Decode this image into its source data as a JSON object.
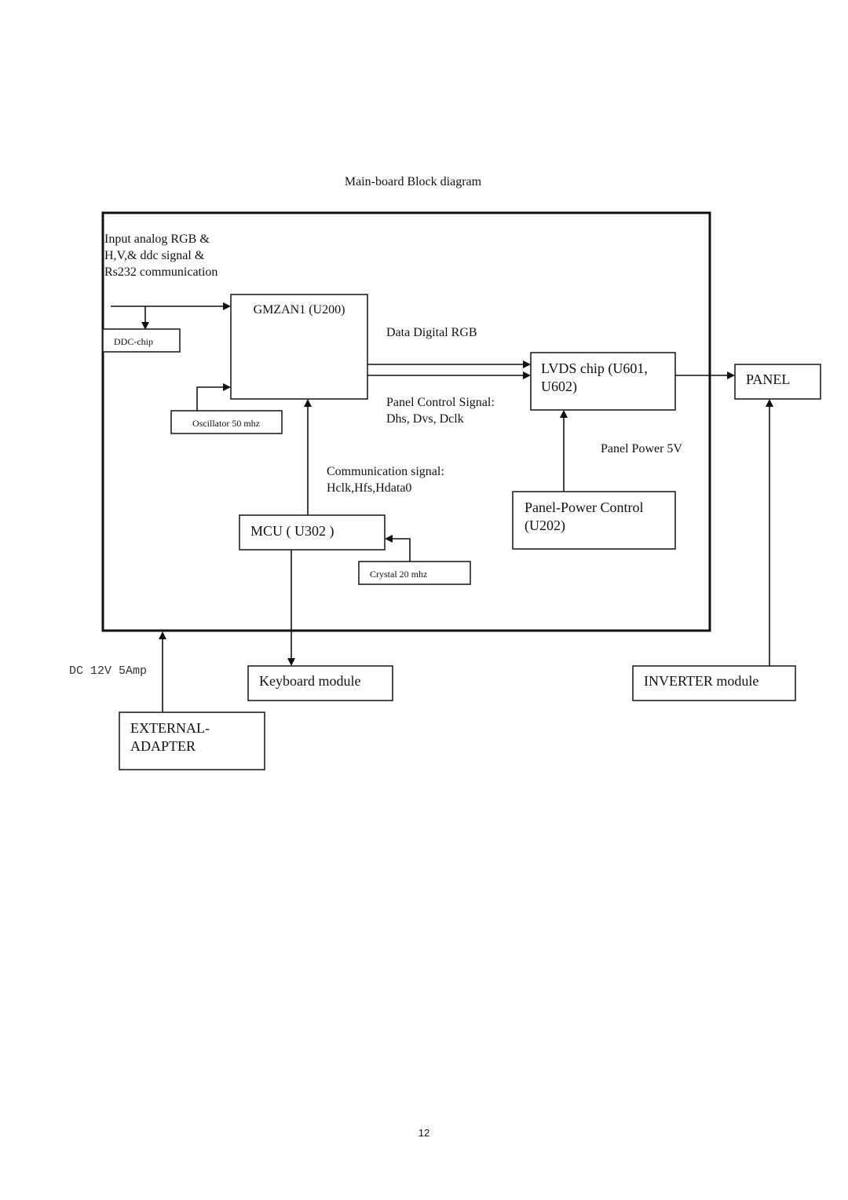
{
  "title": "Main-board Block diagram",
  "page_number": "12",
  "input_label": [
    "Input analog RGB &",
    "H,V,& ddc signal &",
    "Rs232 communication"
  ],
  "blocks": {
    "gmzan": "GMZAN1 (U200)",
    "ddc": "DDC-chip",
    "oscillator": "Oscillator 50 mhz",
    "lvds": [
      "LVDS chip (U601,",
      "U602)"
    ],
    "panel": "PANEL",
    "mcu": "MCU ( U302 )",
    "crystal": "Crystal 20 mhz",
    "panel_power_control": [
      "Panel-Power Control",
      "(U202)"
    ],
    "keyboard": "Keyboard module",
    "inverter": "INVERTER module",
    "adapter": [
      "EXTERNAL-",
      "ADAPTER"
    ]
  },
  "signals": {
    "data_digital_rgb": "Data Digital RGB",
    "panel_control": [
      "Panel Control Signal:",
      "Dhs, Dvs, Dclk"
    ],
    "communication": [
      "Communication signal:",
      "Hclk,Hfs,Hdata0"
    ],
    "panel_power": "Panel Power 5V",
    "dc_power": "DC 12V 5Amp"
  },
  "connections": [
    {
      "from": "input",
      "to": "gmzan"
    },
    {
      "from": "input",
      "to": "ddc"
    },
    {
      "from": "oscillator",
      "to": "gmzan"
    },
    {
      "from": "mcu",
      "to": "gmzan",
      "label": "communication"
    },
    {
      "from": "gmzan",
      "to": "lvds",
      "label": "data_digital_rgb"
    },
    {
      "from": "gmzan",
      "to": "lvds",
      "label": "panel_control"
    },
    {
      "from": "lvds",
      "to": "panel"
    },
    {
      "from": "panel_power_control",
      "to": "lvds",
      "label": "panel_power"
    },
    {
      "from": "crystal",
      "to": "mcu"
    },
    {
      "from": "mcu",
      "to": "keyboard"
    },
    {
      "from": "inverter",
      "to": "panel"
    },
    {
      "from": "adapter",
      "to": "main_board",
      "label": "dc_power"
    }
  ]
}
